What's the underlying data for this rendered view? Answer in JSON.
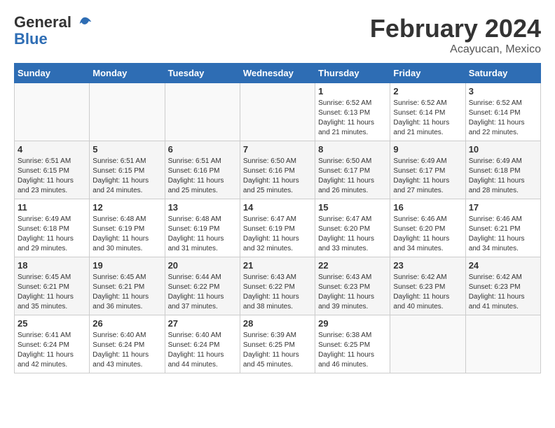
{
  "header": {
    "logo_line1": "General",
    "logo_line2": "Blue",
    "month": "February 2024",
    "location": "Acayucan, Mexico"
  },
  "days_of_week": [
    "Sunday",
    "Monday",
    "Tuesday",
    "Wednesday",
    "Thursday",
    "Friday",
    "Saturday"
  ],
  "weeks": [
    [
      {
        "day": "",
        "empty": true
      },
      {
        "day": "",
        "empty": true
      },
      {
        "day": "",
        "empty": true
      },
      {
        "day": "",
        "empty": true
      },
      {
        "day": "1",
        "sunrise": "6:52 AM",
        "sunset": "6:13 PM",
        "daylight": "11 hours and 21 minutes."
      },
      {
        "day": "2",
        "sunrise": "6:52 AM",
        "sunset": "6:14 PM",
        "daylight": "11 hours and 21 minutes."
      },
      {
        "day": "3",
        "sunrise": "6:52 AM",
        "sunset": "6:14 PM",
        "daylight": "11 hours and 22 minutes."
      }
    ],
    [
      {
        "day": "4",
        "sunrise": "6:51 AM",
        "sunset": "6:15 PM",
        "daylight": "11 hours and 23 minutes."
      },
      {
        "day": "5",
        "sunrise": "6:51 AM",
        "sunset": "6:15 PM",
        "daylight": "11 hours and 24 minutes."
      },
      {
        "day": "6",
        "sunrise": "6:51 AM",
        "sunset": "6:16 PM",
        "daylight": "11 hours and 25 minutes."
      },
      {
        "day": "7",
        "sunrise": "6:50 AM",
        "sunset": "6:16 PM",
        "daylight": "11 hours and 25 minutes."
      },
      {
        "day": "8",
        "sunrise": "6:50 AM",
        "sunset": "6:17 PM",
        "daylight": "11 hours and 26 minutes."
      },
      {
        "day": "9",
        "sunrise": "6:49 AM",
        "sunset": "6:17 PM",
        "daylight": "11 hours and 27 minutes."
      },
      {
        "day": "10",
        "sunrise": "6:49 AM",
        "sunset": "6:18 PM",
        "daylight": "11 hours and 28 minutes."
      }
    ],
    [
      {
        "day": "11",
        "sunrise": "6:49 AM",
        "sunset": "6:18 PM",
        "daylight": "11 hours and 29 minutes."
      },
      {
        "day": "12",
        "sunrise": "6:48 AM",
        "sunset": "6:19 PM",
        "daylight": "11 hours and 30 minutes."
      },
      {
        "day": "13",
        "sunrise": "6:48 AM",
        "sunset": "6:19 PM",
        "daylight": "11 hours and 31 minutes."
      },
      {
        "day": "14",
        "sunrise": "6:47 AM",
        "sunset": "6:19 PM",
        "daylight": "11 hours and 32 minutes."
      },
      {
        "day": "15",
        "sunrise": "6:47 AM",
        "sunset": "6:20 PM",
        "daylight": "11 hours and 33 minutes."
      },
      {
        "day": "16",
        "sunrise": "6:46 AM",
        "sunset": "6:20 PM",
        "daylight": "11 hours and 34 minutes."
      },
      {
        "day": "17",
        "sunrise": "6:46 AM",
        "sunset": "6:21 PM",
        "daylight": "11 hours and 34 minutes."
      }
    ],
    [
      {
        "day": "18",
        "sunrise": "6:45 AM",
        "sunset": "6:21 PM",
        "daylight": "11 hours and 35 minutes."
      },
      {
        "day": "19",
        "sunrise": "6:45 AM",
        "sunset": "6:21 PM",
        "daylight": "11 hours and 36 minutes."
      },
      {
        "day": "20",
        "sunrise": "6:44 AM",
        "sunset": "6:22 PM",
        "daylight": "11 hours and 37 minutes."
      },
      {
        "day": "21",
        "sunrise": "6:43 AM",
        "sunset": "6:22 PM",
        "daylight": "11 hours and 38 minutes."
      },
      {
        "day": "22",
        "sunrise": "6:43 AM",
        "sunset": "6:23 PM",
        "daylight": "11 hours and 39 minutes."
      },
      {
        "day": "23",
        "sunrise": "6:42 AM",
        "sunset": "6:23 PM",
        "daylight": "11 hours and 40 minutes."
      },
      {
        "day": "24",
        "sunrise": "6:42 AM",
        "sunset": "6:23 PM",
        "daylight": "11 hours and 41 minutes."
      }
    ],
    [
      {
        "day": "25",
        "sunrise": "6:41 AM",
        "sunset": "6:24 PM",
        "daylight": "11 hours and 42 minutes."
      },
      {
        "day": "26",
        "sunrise": "6:40 AM",
        "sunset": "6:24 PM",
        "daylight": "11 hours and 43 minutes."
      },
      {
        "day": "27",
        "sunrise": "6:40 AM",
        "sunset": "6:24 PM",
        "daylight": "11 hours and 44 minutes."
      },
      {
        "day": "28",
        "sunrise": "6:39 AM",
        "sunset": "6:25 PM",
        "daylight": "11 hours and 45 minutes."
      },
      {
        "day": "29",
        "sunrise": "6:38 AM",
        "sunset": "6:25 PM",
        "daylight": "11 hours and 46 minutes."
      },
      {
        "day": "",
        "empty": true
      },
      {
        "day": "",
        "empty": true
      }
    ]
  ]
}
